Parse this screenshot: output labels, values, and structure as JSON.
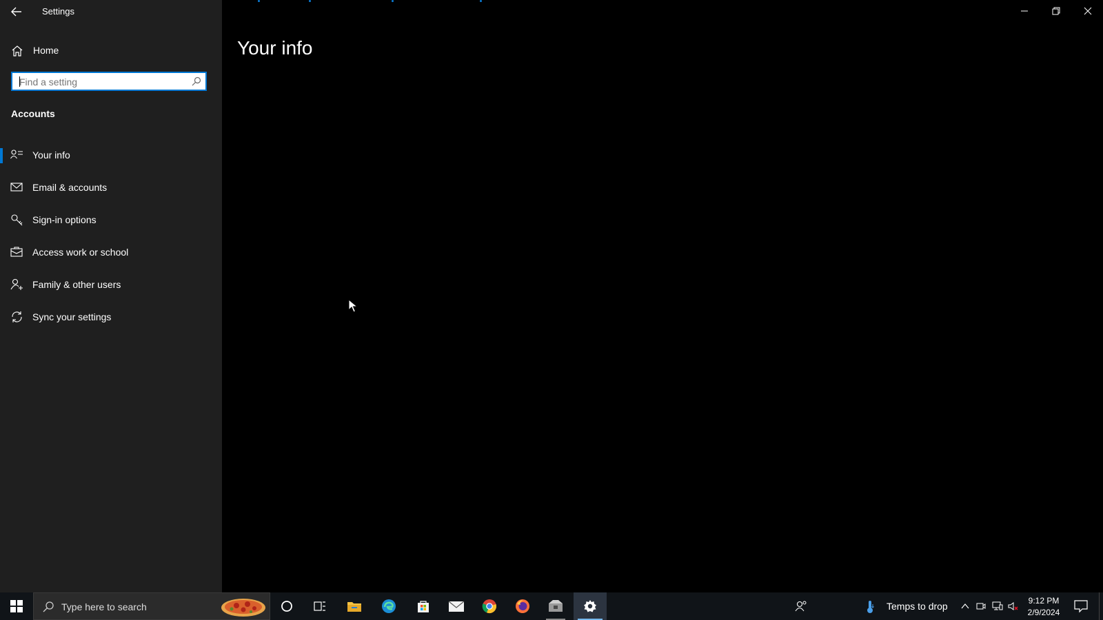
{
  "app": {
    "title": "Settings"
  },
  "sidebar": {
    "home_label": "Home",
    "search": {
      "placeholder": "Find a setting"
    },
    "section_title": "Accounts",
    "items": [
      {
        "label": "Your info",
        "icon": "person-lines-icon",
        "selected": true
      },
      {
        "label": "Email & accounts",
        "icon": "mail-icon",
        "selected": false
      },
      {
        "label": "Sign-in options",
        "icon": "key-icon",
        "selected": false
      },
      {
        "label": "Access work or school",
        "icon": "briefcase-icon",
        "selected": false
      },
      {
        "label": "Family & other users",
        "icon": "person-add-icon",
        "selected": false
      },
      {
        "label": "Sync your settings",
        "icon": "sync-icon",
        "selected": false
      }
    ]
  },
  "main": {
    "page_title": "Your info"
  },
  "taskbar": {
    "search_placeholder": "Type here to search",
    "weather_text": "Temps to drop",
    "time": "9:12 PM",
    "date": "2/9/2024",
    "pinned": [
      "cortana-icon",
      "task-view-icon",
      "file-explorer-icon",
      "edge-icon",
      "store-icon",
      "mail-icon",
      "chrome-icon",
      "firefox-icon",
      "installer-icon",
      "settings-icon"
    ]
  },
  "colors": {
    "accent": "#0078d4",
    "sidebar_bg": "#1f1f1f",
    "main_bg": "#000000",
    "taskbar_bg": "#101418"
  }
}
